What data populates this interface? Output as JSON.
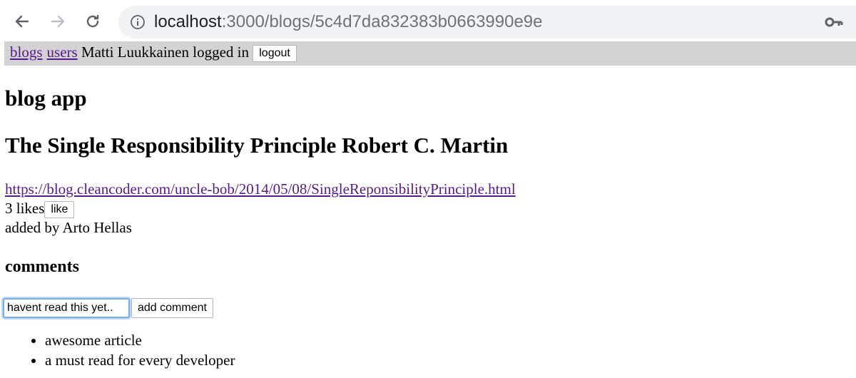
{
  "browser": {
    "url_host": "localhost",
    "url_rest": ":3000/blogs/5c4d7da832383b0663990e9e",
    "colors": {
      "omnibox": "#f1f3f4",
      "link_visited": "#551a8b",
      "menu_bg": "#d3d3d3"
    }
  },
  "menu": {
    "blogs_label": "blogs",
    "users_label": "users",
    "user_status": "Matti Luukkainen logged in",
    "logout_label": "logout"
  },
  "page": {
    "app_title": "blog app",
    "blog_title": "The Single Responsibility Principle Robert C. Martin",
    "blog_url": "https://blog.cleancoder.com/uncle-bob/2014/05/08/SingleReponsibilityPrinciple.html",
    "likes_text": "3 likes",
    "like_label": "like",
    "added_by": "added by Arto Hellas",
    "comments_title": "comments",
    "comment_input_value": "havent read this yet..",
    "add_comment_label": "add comment",
    "comments": [
      "awesome article",
      "a must read for every developer"
    ]
  }
}
